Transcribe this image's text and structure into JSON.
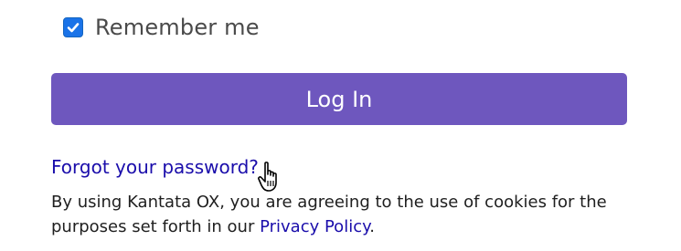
{
  "remember": {
    "label": "Remember me",
    "checked": true,
    "icon": "checkmark-icon"
  },
  "login": {
    "button_label": "Log In",
    "color": "#6e57be"
  },
  "forgot": {
    "link_text": "Forgot your password?"
  },
  "cookies": {
    "text_before": "By using Kantata OX, you are agreeing to the use of cookies for the purposes set forth in our ",
    "link_text": "Privacy Policy",
    "text_after": "."
  },
  "cursor": {
    "icon": "hand-pointer-icon"
  },
  "colors": {
    "link": "#1a0dab",
    "checkbox": "#1a73e8"
  }
}
